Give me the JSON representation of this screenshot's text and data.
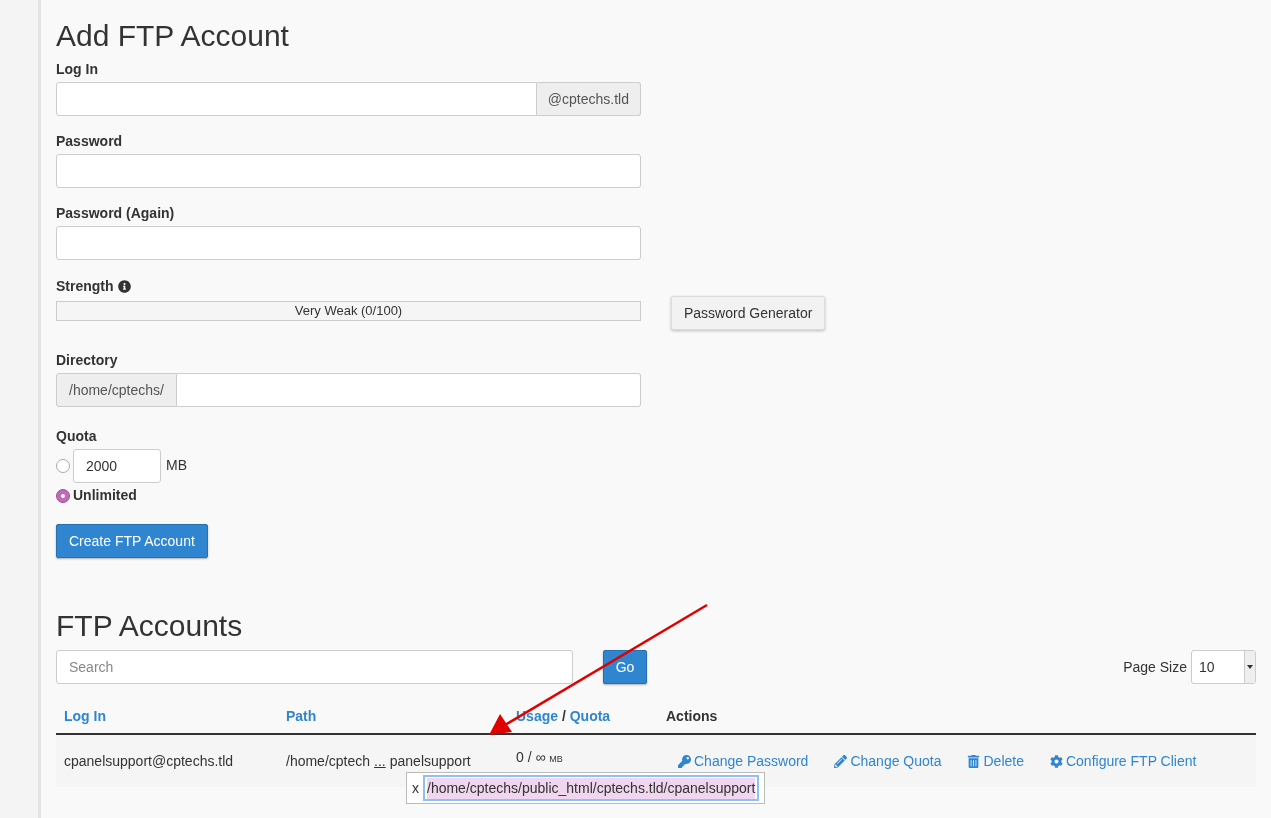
{
  "add_section": {
    "title": "Add FTP Account",
    "login": {
      "label": "Log In",
      "suffix": "@cptechs.tld"
    },
    "password": {
      "label": "Password"
    },
    "password_again": {
      "label": "Password (Again)"
    },
    "strength": {
      "label": "Strength",
      "meter_text": "Very Weak (0/100)",
      "level": 0,
      "generator_button": "Password Generator"
    },
    "directory": {
      "label": "Directory",
      "prefix": "/home/cptechs/"
    },
    "quota": {
      "label": "Quota",
      "options": [
        {
          "kind": "amount",
          "value": "2000",
          "unit": "MB",
          "selected": false
        },
        {
          "kind": "unlimited",
          "label": "Unlimited",
          "selected": true
        }
      ]
    },
    "submit": "Create FTP Account"
  },
  "accounts_section": {
    "title": "FTP Accounts",
    "search": {
      "placeholder": "Search"
    },
    "go_button": "Go",
    "page_size": {
      "label": "Page Size",
      "value": "10"
    },
    "columns": [
      {
        "kind": "link",
        "label": "Log In"
      },
      {
        "kind": "link",
        "label": "Path"
      },
      {
        "kind": "pair",
        "labels": [
          "Usage",
          "Quota"
        ],
        "separator": "/"
      },
      {
        "kind": "plain",
        "label": "Actions"
      }
    ],
    "rows": [
      {
        "login": "cpanelsupport@cptechs.tld",
        "path_start": "/home/cptech",
        "ellipsis": "...",
        "path_end": "panelsupport",
        "usage": "0 / ∞",
        "usage_unit": "MB",
        "actions": [
          "Change Password",
          "Change Quota",
          "Delete",
          "Configure FTP Client"
        ]
      }
    ],
    "path_popup": {
      "close": "x",
      "value": "/home/cptechs/public_html/cptechs.tld/cpanelsupport"
    }
  }
}
